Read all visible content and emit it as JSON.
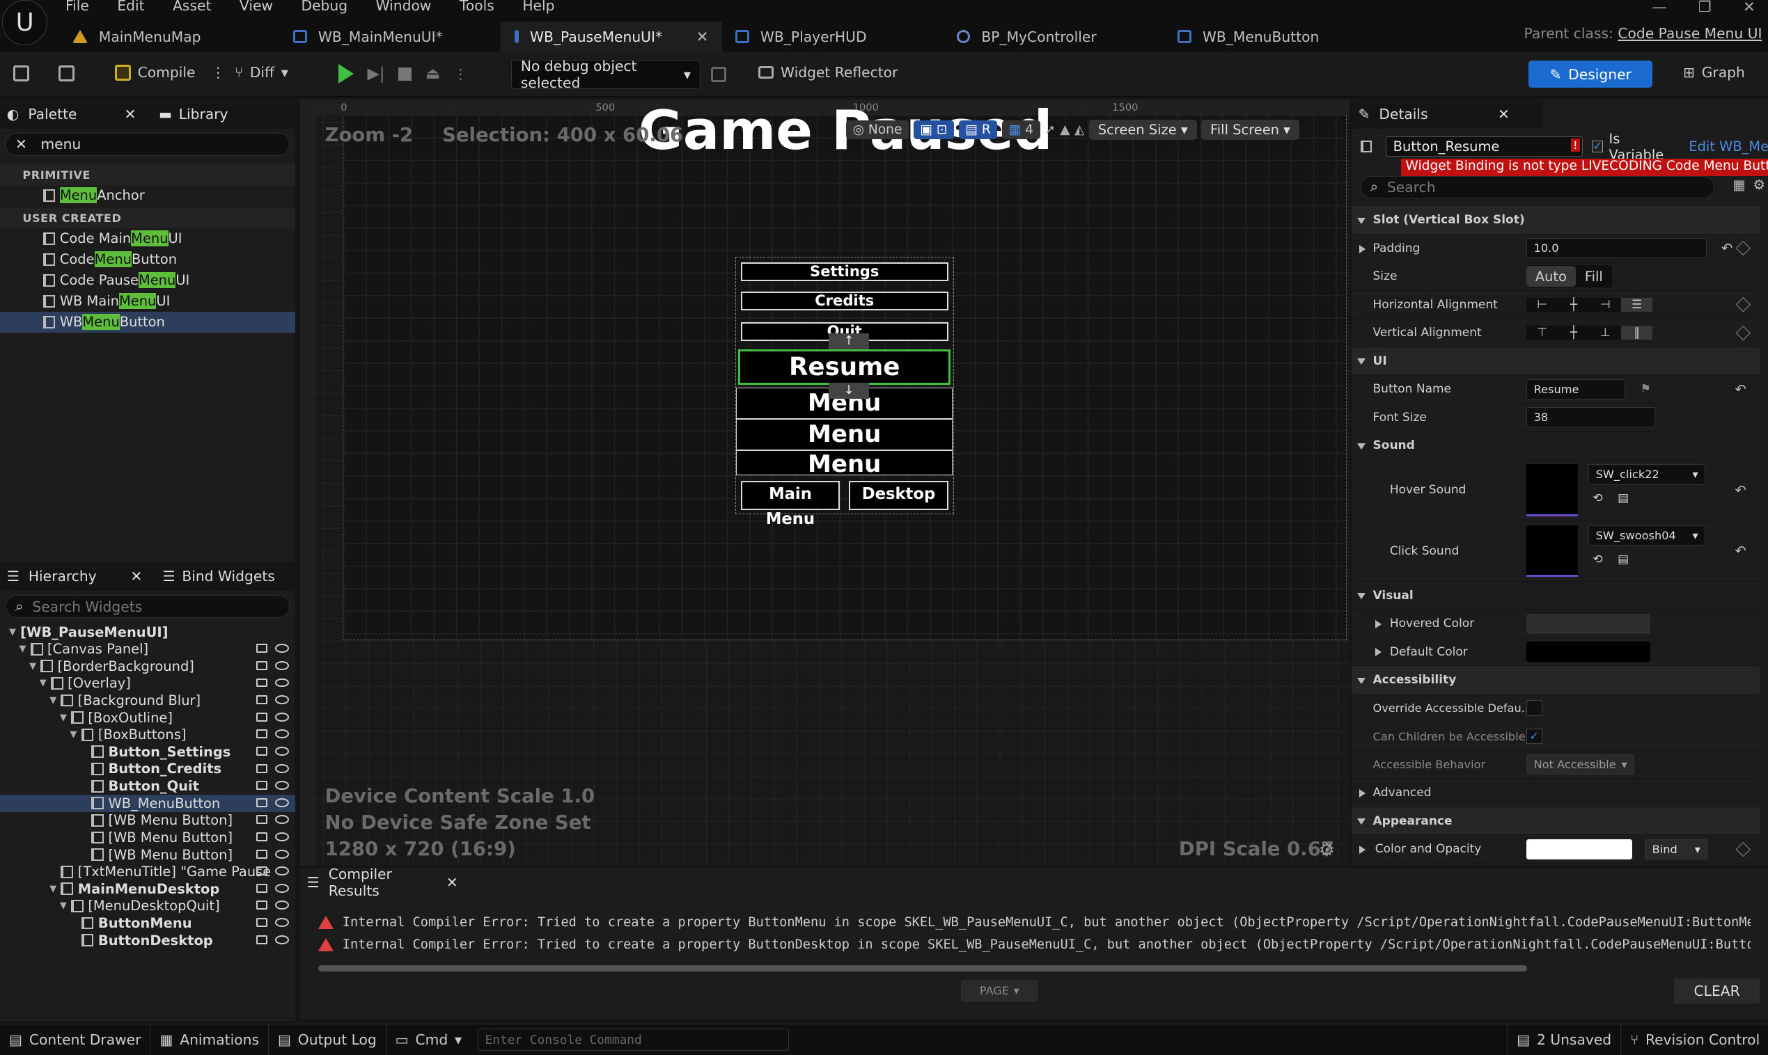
{
  "menu_bar": [
    "File",
    "Edit",
    "Asset",
    "View",
    "Debug",
    "Window",
    "Tools",
    "Help"
  ],
  "tabs": [
    {
      "label": "MainMenuMap",
      "icon": "map-icon"
    },
    {
      "label": "WB_MainMenuUI*",
      "icon": "widget-icon"
    },
    {
      "label": "WB_PauseMenuUI*",
      "icon": "widget-icon",
      "active": true
    },
    {
      "label": "WB_PlayerHUD",
      "icon": "widget-icon"
    },
    {
      "label": "BP_MyController",
      "icon": "controller-icon"
    },
    {
      "label": "WB_MenuButton",
      "icon": "widget-icon"
    }
  ],
  "parent_class": {
    "label": "Parent class:",
    "value": "Code Pause Menu UI"
  },
  "toolbar": {
    "compile": "Compile",
    "diff": "Diff",
    "debug_object": "No debug object selected",
    "widget_reflector": "Widget Reflector",
    "designer": "Designer",
    "graph": "Graph"
  },
  "palette": {
    "tab": "Palette",
    "library_tab": "Library",
    "search_value": "menu",
    "categories": [
      {
        "name": "PRIMITIVE",
        "items": [
          {
            "pre": "",
            "hl": "Menu",
            "post": " Anchor"
          }
        ]
      },
      {
        "name": "USER CREATED",
        "items": [
          {
            "pre": "Code Main ",
            "hl": "Menu",
            "post": " UI"
          },
          {
            "pre": "Code ",
            "hl": "Menu",
            "post": " Button"
          },
          {
            "pre": "Code Pause ",
            "hl": "Menu",
            "post": " UI"
          },
          {
            "pre": "WB Main ",
            "hl": "Menu",
            "post": " UI"
          },
          {
            "pre": "WB ",
            "hl": "Menu",
            "post": " Button",
            "selected": true
          }
        ]
      }
    ]
  },
  "hierarchy": {
    "tab": "Hierarchy",
    "bind_tab": "Bind Widgets",
    "search_placeholder": "Search Widgets",
    "items": [
      {
        "label": "[WB_PauseMenuUI]",
        "indent": 0,
        "bold": true
      },
      {
        "label": "[Canvas Panel]",
        "indent": 1
      },
      {
        "label": "[BorderBackground]",
        "indent": 2
      },
      {
        "label": "[Overlay]",
        "indent": 3
      },
      {
        "label": "[Background Blur]",
        "indent": 4
      },
      {
        "label": "[BoxOutline]",
        "indent": 5
      },
      {
        "label": "[BoxButtons]",
        "indent": 6
      },
      {
        "label": "Button_Settings",
        "indent": 7,
        "bold": true
      },
      {
        "label": "Button_Credits",
        "indent": 7,
        "bold": true
      },
      {
        "label": "Button_Quit",
        "indent": 7,
        "bold": true
      },
      {
        "label": "WB_MenuButton",
        "indent": 7,
        "selected": true
      },
      {
        "label": "[WB Menu Button]",
        "indent": 7
      },
      {
        "label": "[WB Menu Button]",
        "indent": 7
      },
      {
        "label": "[WB Menu Button]",
        "indent": 7
      },
      {
        "label": "[TxtMenuTitle] \"Game Pause",
        "indent": 4
      },
      {
        "label": "MainMenuDesktop",
        "indent": 4,
        "bold": true
      },
      {
        "label": "[MenuDesktopQuit]",
        "indent": 5
      },
      {
        "label": "ButtonMenu",
        "indent": 6,
        "bold": true
      },
      {
        "label": "ButtonDesktop",
        "indent": 6,
        "bold": true
      }
    ]
  },
  "viewport": {
    "zoom": "Zoom -2",
    "selection": "Selection: 400 x 60.06",
    "title": "Game Paused",
    "ruler_marks": [
      "0",
      "500",
      "1000",
      "1500"
    ],
    "tool_none": "None",
    "tool_r": "R",
    "tool_4": "4",
    "screen_size": "Screen Size",
    "fill_screen": "Fill Screen",
    "device_scale": "Device Content Scale 1.0",
    "safe_zone": "No Device Safe Zone Set",
    "resolution": "1280 x 720 (16:9)",
    "dpi": "DPI Scale 0.67",
    "buttons": [
      "Settings",
      "Credits",
      "Quit"
    ],
    "resume": "Resume",
    "menu_items": [
      "Menu",
      "Menu",
      "Menu"
    ],
    "bottom_left": "Main Menu",
    "bottom_right": "Desktop"
  },
  "details": {
    "tab": "Details",
    "name_value": "Button_Resume",
    "is_variable": "Is Variable",
    "edit_link": "Edit WB_Me",
    "error": "Widget Binding is not type LIVECODING Code Menu Button",
    "search_placeholder": "Search",
    "slot_section": "Slot (Vertical Box Slot)",
    "padding_label": "Padding",
    "padding_value": "10.0",
    "size_label": "Size",
    "size_auto": "Auto",
    "size_fill": "Fill",
    "halign_label": "Horizontal Alignment",
    "valign_label": "Vertical Alignment",
    "ui_section": "UI",
    "button_name_label": "Button Name",
    "button_name_value": "Resume",
    "font_size_label": "Font Size",
    "font_size_value": "38",
    "sound_section": "Sound",
    "hover_label": "Hover Sound",
    "hover_value": "SW_click22",
    "click_label": "Click Sound",
    "click_value": "SW_swoosh04",
    "visual_section": "Visual",
    "hovered_label": "Hovered Color",
    "default_label": "Default Color",
    "access_section": "Accessibility",
    "override_label": "Override Accessible Defau...",
    "children_label": "Can Children be Accessible",
    "behavior_label": "Accessible Behavior",
    "behavior_value": "Not Accessible",
    "advanced_section": "Advanced",
    "appearance_section": "Appearance",
    "color_label": "Color and Opacity",
    "bind": "Bind"
  },
  "compiler": {
    "tab": "Compiler Results",
    "errors": [
      "Internal Compiler Error: Tried to create a property ButtonMenu in scope SKEL_WB_PauseMenuUI_C, but another object (ObjectProperty /Script/OperationNightfall.CodePauseMenuUI:ButtonMenu",
      "Internal Compiler Error: Tried to create a property ButtonDesktop in scope SKEL_WB_PauseMenuUI_C, but another object (ObjectProperty /Script/OperationNightfall.CodePauseMenuUI:ButtonD"
    ],
    "page": "PAGE",
    "clear": "CLEAR"
  },
  "status_bar": {
    "content_drawer": "Content Drawer",
    "animations": "Animations",
    "output_log": "Output Log",
    "cmd": "Cmd",
    "console_placeholder": "Enter Console Command",
    "unsaved": "2 Unsaved",
    "revision": "Revision Control"
  },
  "colors": {
    "accent": "#1a6ad0",
    "selected": "#2c3e5c",
    "highlight": "#5ebe3c",
    "error": "#c01010",
    "resume_outline": "#3fbf3f"
  }
}
